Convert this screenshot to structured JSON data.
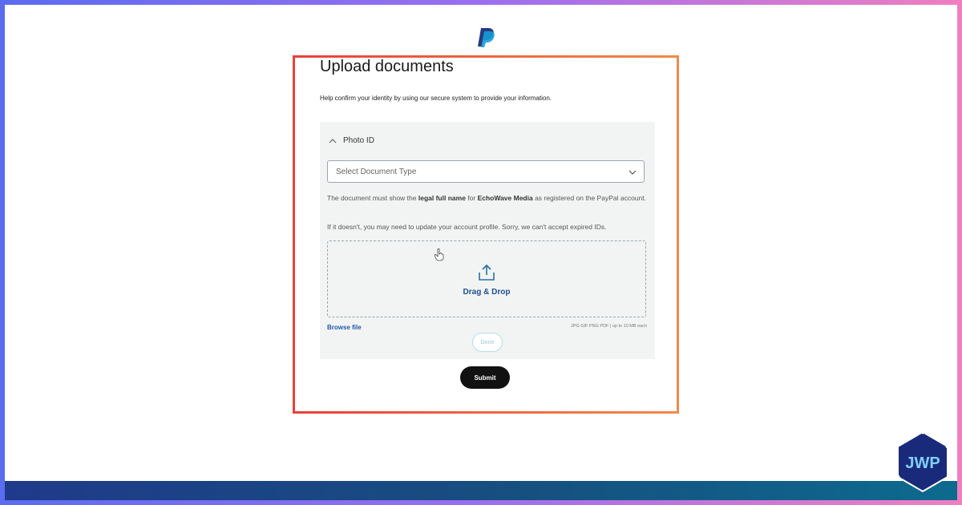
{
  "brand": {
    "logo_icon": "paypal-logo-icon",
    "accent": "#1f5aa8"
  },
  "page": {
    "title": "Upload documents",
    "subtitle": "Help confirm your identity by using our secure system to provide your information."
  },
  "panel": {
    "header": "Photo ID",
    "select": {
      "placeholder": "Select Document Type"
    },
    "note1": {
      "p1": "The document must show the ",
      "b1": "legal full name",
      "p2": " for ",
      "b2": "EchoWave Media",
      "p3": " as registered on the PayPal account."
    },
    "note2": "If it doesn't, you may need to update your account profile. Sorry, we can't accept expired IDs.",
    "dropzone": {
      "label": "Drag & Drop",
      "icon": "upload-icon"
    },
    "browse_label": "Browse file",
    "file_types": "JPG GIF PNG PDF | up to 10 MB each",
    "done_label": "Done"
  },
  "submit_label": "Submit",
  "watermark": {
    "text": "JWP"
  },
  "colors": {
    "frame_gradient": [
      "#5b6cf0",
      "#f07fc0"
    ],
    "highlight": [
      "#e8403a",
      "#f08a4a"
    ],
    "submit_bg": "#111111"
  }
}
